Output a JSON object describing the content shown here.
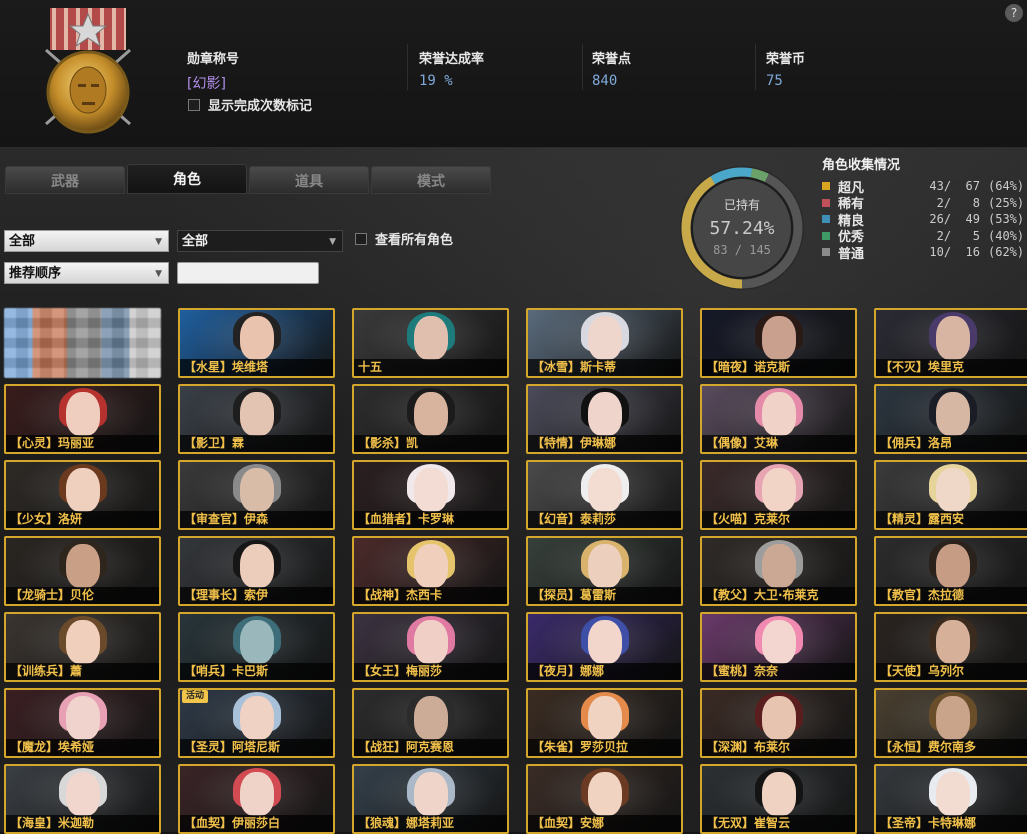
{
  "help_label": "?",
  "header": {
    "medal_title_label": "勋章称号",
    "medal_title_value": "[幻影]",
    "show_marker_label": "显示完成次数标记",
    "honor_rate_label": "荣誉达成率",
    "honor_rate_value": "19 %",
    "honor_points_label": "荣誉点",
    "honor_points_value": "840",
    "honor_coins_label": "荣誉币",
    "honor_coins_value": "75"
  },
  "tabs": [
    {
      "label": "武器",
      "active": false
    },
    {
      "label": "角色",
      "active": true
    },
    {
      "label": "道具",
      "active": false
    },
    {
      "label": "模式",
      "active": false
    }
  ],
  "filters": {
    "category_value": "全部",
    "subcategory_value": "全部",
    "sort_value": "推荐顺序",
    "search_value": "",
    "show_all_label": "查看所有角色"
  },
  "collection": {
    "owned_label": "已持有",
    "owned_percent": "57.24%",
    "owned_count": "83 / 145",
    "owned_fraction": 0.5724,
    "title": "角色收集情况",
    "rarities": [
      {
        "name": "超凡",
        "count": "43/  67",
        "percent": "(64%)",
        "color": "#d9a520"
      },
      {
        "name": "稀有",
        "count": " 2/   8",
        "percent": "(25%)",
        "color": "#c0505a"
      },
      {
        "name": "精良",
        "count": "26/  49",
        "percent": "(53%)",
        "color": "#3f8fb8"
      },
      {
        "name": "优秀",
        "count": " 2/   5",
        "percent": "(40%)",
        "color": "#3f9a66"
      },
      {
        "name": "普通",
        "count": "10/  16",
        "percent": "(62%)",
        "color": "#8a8a8a"
      }
    ]
  },
  "characters": [
    {
      "name": "",
      "blurred": true
    },
    {
      "name": "【水星】埃维塔",
      "bg": "#1f5f9f",
      "skin": "#e9c3ad",
      "hair": "#222"
    },
    {
      "name": "十五",
      "bg": "#3a3a3a",
      "skin": "#e0bfae",
      "hair": "#1d7b7b"
    },
    {
      "name": "【冰雪】斯卡蒂",
      "bg": "#5a6b7c",
      "skin": "#efd6cc",
      "hair": "#d8d8e0"
    },
    {
      "name": "【暗夜】诺克斯",
      "bg": "#151827",
      "skin": "#c9a08e",
      "hair": "#2a1a16"
    },
    {
      "name": "【不灭】埃里克",
      "bg": "#2b2b35",
      "skin": "#d7b5a2",
      "hair": "#4a3a6a"
    },
    {
      "name": "【心灵】玛丽亚",
      "bg": "#3a1c1c",
      "skin": "#efcdbf",
      "hair": "#b5322f"
    },
    {
      "name": "【影卫】霖",
      "bg": "#3a4048",
      "skin": "#e3c3b2",
      "hair": "#1e1e1e"
    },
    {
      "name": "【影杀】凯",
      "bg": "#2d2d2d",
      "skin": "#d8b49e",
      "hair": "#1b1b1b"
    },
    {
      "name": "【特情】伊琳娜",
      "bg": "#4b4b5a",
      "skin": "#efd4cc",
      "hair": "#111"
    },
    {
      "name": "【偶像】艾琳",
      "bg": "#5a4c5e",
      "skin": "#f1d2c9",
      "hair": "#e58aa8"
    },
    {
      "name": "【佣兵】洛昂",
      "bg": "#2c3640",
      "skin": "#d6b7a4",
      "hair": "#1a1d25"
    },
    {
      "name": "【少女】洛妍",
      "bg": "#2e2a26",
      "skin": "#efcfbd",
      "hair": "#6b3a1e"
    },
    {
      "name": "【审查官】伊森",
      "bg": "#3a3a3a",
      "skin": "#d9bca8",
      "hair": "#8a8a8a"
    },
    {
      "name": "【血猎者】卡罗琳",
      "bg": "#2b1f21",
      "skin": "#f2dcd3",
      "hair": "#f0e8ea"
    },
    {
      "name": "【幻音】泰莉莎",
      "bg": "#4a4a4a",
      "skin": "#f3dcd2",
      "hair": "#eeeeee"
    },
    {
      "name": "【火喵】克莱尔",
      "bg": "#3b2a2a",
      "skin": "#f2d4c6",
      "hair": "#e7a4b3"
    },
    {
      "name": "【精灵】露西安",
      "bg": "#3b3b3b",
      "skin": "#f0d8c8",
      "hair": "#e6d49a"
    },
    {
      "name": "【龙骑士】贝伦",
      "bg": "#2a2622",
      "skin": "#c9a086",
      "hair": "#2e251c"
    },
    {
      "name": "【理事长】索伊",
      "bg": "#34373b",
      "skin": "#ecccba",
      "hair": "#161616"
    },
    {
      "name": "【战神】杰西卡",
      "bg": "#4b2a2a",
      "skin": "#f0d0bd",
      "hair": "#e6c46c"
    },
    {
      "name": "【探员】葛雷斯",
      "bg": "#37403a",
      "skin": "#ecd0bd",
      "hair": "#d9b36c"
    },
    {
      "name": "【教父】大卫·布莱克",
      "bg": "#302b28",
      "skin": "#caa893",
      "hair": "#9d9d9d"
    },
    {
      "name": "【教官】杰拉德",
      "bg": "#2c2c2c",
      "skin": "#c69c84",
      "hair": "#2a221b"
    },
    {
      "name": "【训练兵】蕭",
      "bg": "#3b3530",
      "skin": "#f0d0bd",
      "hair": "#6b4a2b"
    },
    {
      "name": "【哨兵】卡巴斯",
      "bg": "#28353a",
      "skin": "#9ab7bb",
      "hair": "#3c6d78"
    },
    {
      "name": "【女王】梅丽莎",
      "bg": "#3b3240",
      "skin": "#f0d0c6",
      "hair": "#e07aa2"
    },
    {
      "name": "【夜月】娜娜",
      "bg": "#3a2a6a",
      "skin": "#f2d6cc",
      "hair": "#3e4fa8"
    },
    {
      "name": "【蜜桃】奈奈",
      "bg": "#6a3a6a",
      "skin": "#f3d6cf",
      "hair": "#f08ab0"
    },
    {
      "name": "【天使】乌列尔",
      "bg": "#2a2420",
      "skin": "#d7b09a",
      "hair": "#3b2a1e"
    },
    {
      "name": "【魔龙】埃希娅",
      "bg": "#3b1f22",
      "skin": "#f0d3cd",
      "hair": "#e7a0b4"
    },
    {
      "name": "【圣灵】阿塔尼斯",
      "bg": "#2e3a48",
      "skin": "#efd2c3",
      "hair": "#a9c1d8",
      "tag": "活动"
    },
    {
      "name": "【战狂】阿克赛恩",
      "bg": "#2c2c2c",
      "skin": "#ccab97",
      "hair": "#2b2b2b"
    },
    {
      "name": "【朱雀】罗莎贝拉",
      "bg": "#3a2c22",
      "skin": "#f0d3c1",
      "hair": "#e48a4a"
    },
    {
      "name": "【深渊】布莱尔",
      "bg": "#3a2a24",
      "skin": "#e6c4b0",
      "hair": "#5a1e1e"
    },
    {
      "name": "【永恒】费尔南多",
      "bg": "#4a4030",
      "skin": "#c9a48a",
      "hair": "#6a4e2a"
    },
    {
      "name": "【海皇】米迦勒",
      "bg": "#3a3f44",
      "skin": "#f0d6cc",
      "hair": "#d8d8d8"
    },
    {
      "name": "【血契】伊丽莎白",
      "bg": "#3a2426",
      "skin": "#f0d3c8",
      "hair": "#d24a52"
    },
    {
      "name": "【狼魂】娜塔莉亚",
      "bg": "#34404a",
      "skin": "#eed4c9",
      "hair": "#aab8c8"
    },
    {
      "name": "【血契】安娜",
      "bg": "#3a2c26",
      "skin": "#f0d3c1",
      "hair": "#6a3a22"
    },
    {
      "name": "【无双】崔智云",
      "bg": "#2c3134",
      "skin": "#efd2c2",
      "hair": "#141414"
    },
    {
      "name": "【圣帝】卡特琳娜",
      "bg": "#34383c",
      "skin": "#f2dbd1",
      "hair": "#e8ecf0"
    }
  ]
}
